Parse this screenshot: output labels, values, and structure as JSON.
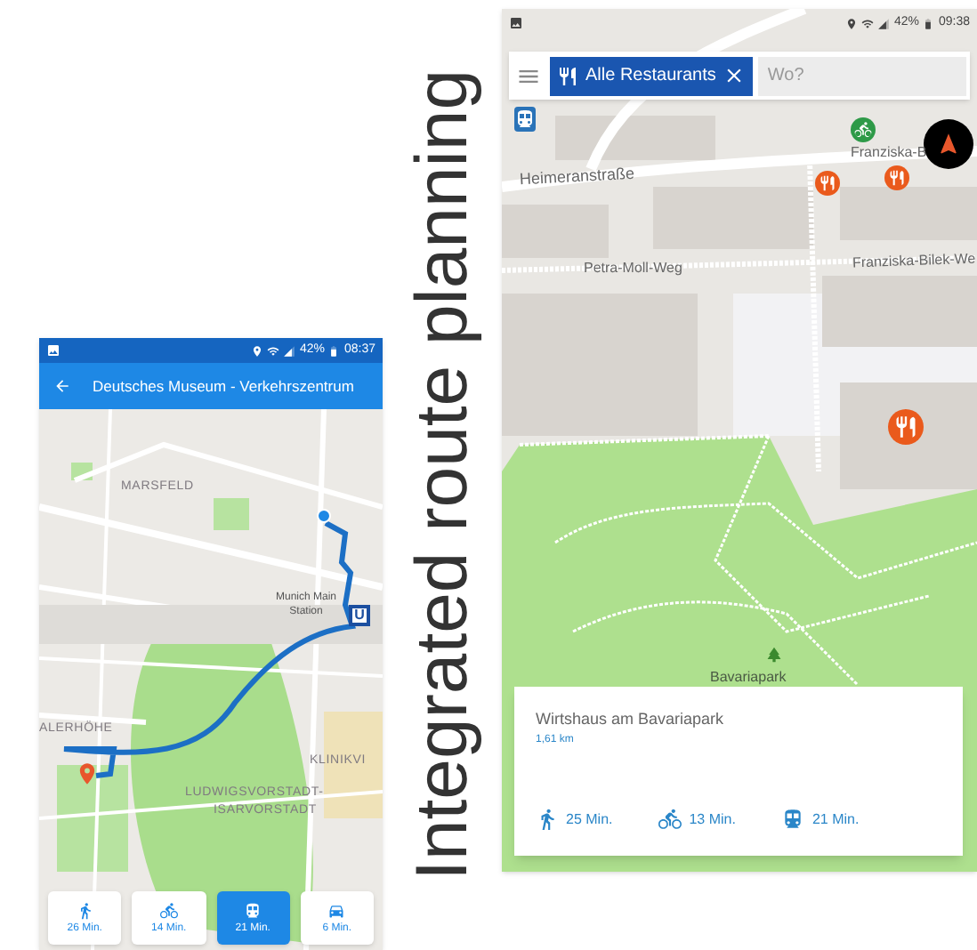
{
  "left_phone": {
    "status_bar": {
      "battery": "42%",
      "time": "08:37"
    },
    "app_bar": {
      "title": "Deutsches Museum - Verkehrszentrum"
    },
    "map_labels": [
      {
        "text": "MARSFELD",
        "kind": "district"
      },
      {
        "text": "Munich Main Station",
        "kind": "poi"
      },
      {
        "text": "ALERHÖHE",
        "kind": "district"
      },
      {
        "text": "KLINIKVI",
        "kind": "district"
      },
      {
        "text": "LUDWIGSVORSTADT-",
        "kind": "district"
      },
      {
        "text": "ISARVORSTADT",
        "kind": "district"
      }
    ],
    "transit_sign": "U",
    "travel_modes": [
      {
        "kind": "walk",
        "duration": "26 Min.",
        "selected": false
      },
      {
        "kind": "bike",
        "duration": "14 Min.",
        "selected": false
      },
      {
        "kind": "transit",
        "duration": "21 Min.",
        "selected": true
      },
      {
        "kind": "car",
        "duration": "6 Min.",
        "selected": false
      }
    ]
  },
  "headline": "Integrated route planning",
  "right_phone": {
    "status_bar": {
      "battery": "42%",
      "time": "09:38"
    },
    "search": {
      "category": "Alle Restaurants",
      "placeholder": "Wo?"
    },
    "map_labels": [
      {
        "text": "Heimeranstraße",
        "kind": "street"
      },
      {
        "text": "Franziska-B",
        "kind": "street"
      },
      {
        "text": "Petra-Moll-Weg",
        "kind": "street"
      },
      {
        "text": "Franziska-Bilek-We",
        "kind": "street"
      },
      {
        "text": "Bavariapark",
        "kind": "park"
      }
    ],
    "place_card": {
      "name": "Wirtshaus am Bavariapark",
      "distance": "1,61 km",
      "travel_times": [
        {
          "kind": "walk",
          "duration": "25 Min."
        },
        {
          "kind": "bike",
          "duration": "13 Min."
        },
        {
          "kind": "transit",
          "duration": "21 Min."
        }
      ]
    }
  }
}
